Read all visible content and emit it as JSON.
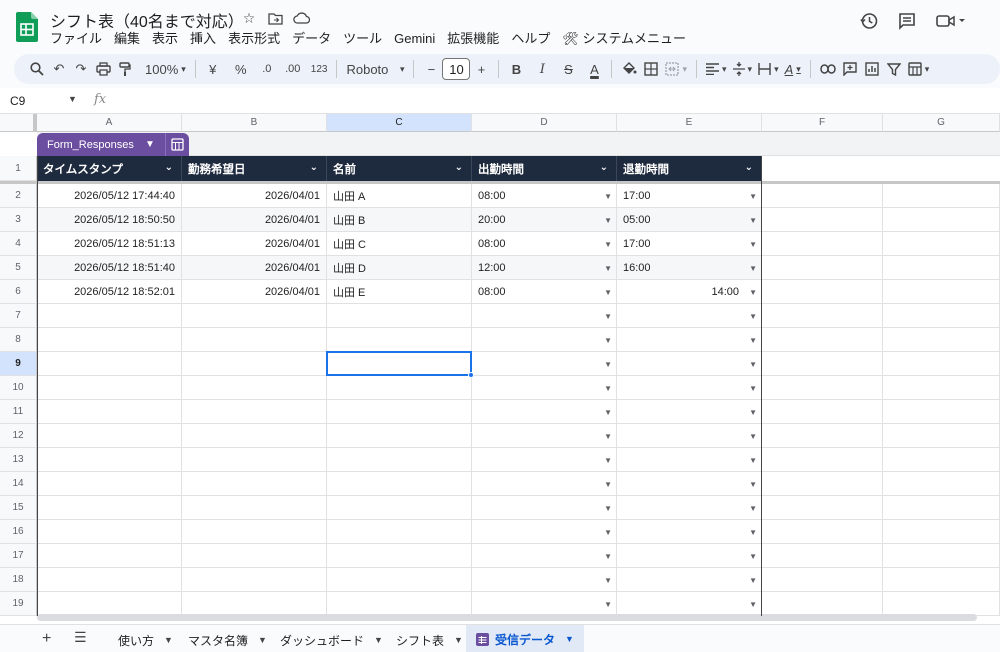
{
  "doc": {
    "title": "シフト表（40名まで対応）"
  },
  "menu": [
    "ファイル",
    "編集",
    "表示",
    "挿入",
    "表示形式",
    "データ",
    "ツール",
    "Gemini",
    "拡張機能",
    "ヘルプ",
    "🛠 システムメニュー"
  ],
  "toolbar": {
    "zoom": "100%",
    "currency": "¥",
    "percent": "%",
    "dec_decrease": ".0",
    "dec_increase": ".00",
    "number_format": "123",
    "font": "Roboto",
    "font_size": "10",
    "minus": "−",
    "plus": "+",
    "bold": "B",
    "italic": "I",
    "strike": "S",
    "text_color": "A",
    "text_rotate": "A"
  },
  "formula_bar": {
    "cell_ref": "C9",
    "fx": "fx"
  },
  "columns": [
    "A",
    "B",
    "C",
    "D",
    "E",
    "F",
    "G"
  ],
  "rows": [
    "1",
    "2",
    "3",
    "4",
    "5",
    "6",
    "7",
    "8",
    "9",
    "10",
    "11",
    "12",
    "13",
    "14",
    "15",
    "16",
    "17",
    "18",
    "19"
  ],
  "selected": {
    "column": "C",
    "row": "9"
  },
  "table": {
    "name": "Form_Responses",
    "headers": [
      "タイムスタンプ",
      "勤務希望日",
      "名前",
      "出勤時間",
      "退勤時間"
    ],
    "rows": [
      [
        "2026/05/12 17:44:40",
        "2026/04/01",
        "山田 A",
        "08:00",
        "17:00"
      ],
      [
        "2026/05/12 18:50:50",
        "2026/04/01",
        "山田 B",
        "20:00",
        "05:00"
      ],
      [
        "2026/05/12 18:51:13",
        "2026/04/01",
        "山田 C",
        "08:00",
        "17:00"
      ],
      [
        "2026/05/12 18:51:40",
        "2026/04/01",
        "山田 D",
        "12:00",
        "16:00"
      ],
      [
        "2026/05/12 18:52:01",
        "2026/04/01",
        "山田 E",
        "08:00",
        "14:00"
      ]
    ]
  },
  "sheets": [
    "使い方",
    "マスタ名簿",
    "ダッシュボード",
    "シフト表",
    "受信データ"
  ],
  "active_sheet": "受信データ",
  "colors": {
    "header_bg": "#1e2a3e",
    "table_tag": "#6b4ea0",
    "selection": "#1a73e8",
    "active_tab": "#0b57d0"
  }
}
